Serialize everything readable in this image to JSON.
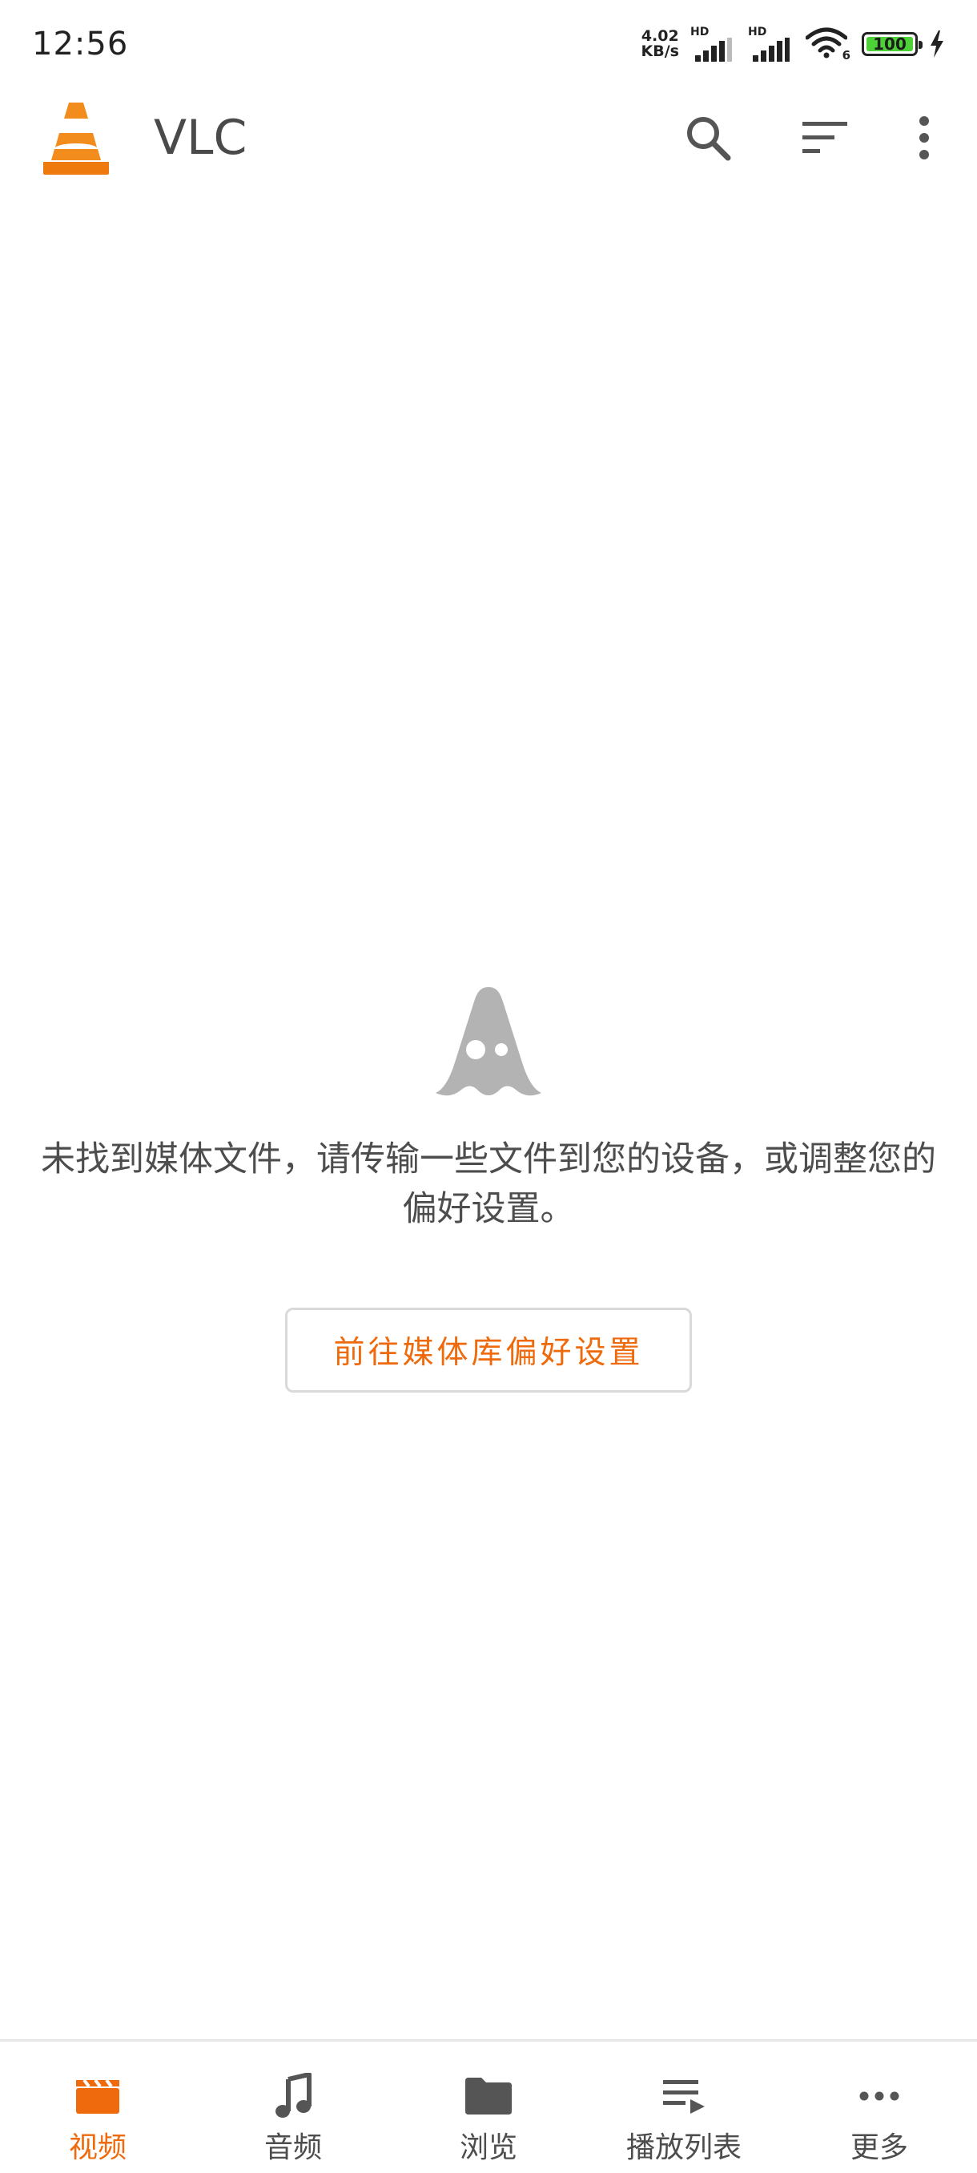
{
  "status_bar": {
    "time": "12:56",
    "net_speed_value": "4.02",
    "net_speed_unit": "KB/s",
    "signal_1_label": "HD",
    "signal_2_label": "HD",
    "wifi_label": "6",
    "battery_level": "100",
    "battery_fraction": 1.0
  },
  "app_bar": {
    "title": "VLC",
    "logo_icon": "vlc-cone-icon",
    "actions": [
      "search-icon",
      "sort-icon",
      "more-vert-icon"
    ]
  },
  "empty_state": {
    "icon": "ghost-cone-icon",
    "message": "未找到媒体文件，请传输一些文件到您的设备，或调整您的偏好设置。",
    "button_label": "前往媒体库偏好设置"
  },
  "bottom_nav": {
    "active_index": 0,
    "items": [
      {
        "label": "视频",
        "icon": "clapperboard-icon"
      },
      {
        "label": "音频",
        "icon": "music-note-icon"
      },
      {
        "label": "浏览",
        "icon": "folder-icon"
      },
      {
        "label": "播放列表",
        "icon": "playlist-icon"
      },
      {
        "label": "更多",
        "icon": "more-horiz-icon"
      }
    ]
  },
  "colors": {
    "accent": "#ee6a0c",
    "text_primary": "#4d4d4d",
    "icon_gray": "#555555",
    "ghost_gray": "#b3b3b3",
    "battery_green": "#4cd137"
  }
}
